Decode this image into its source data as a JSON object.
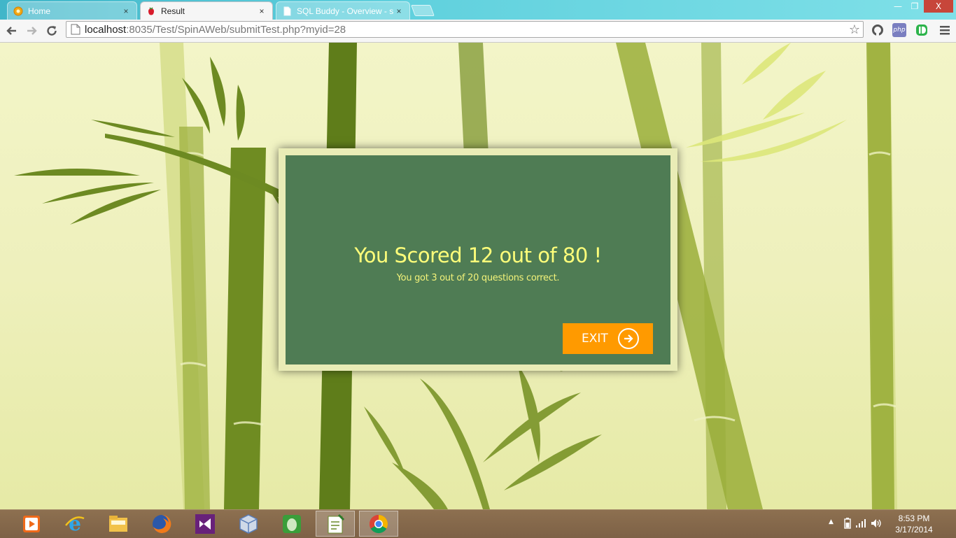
{
  "browser": {
    "tabs": [
      {
        "title": "Home",
        "active": false
      },
      {
        "title": "Result",
        "active": true
      },
      {
        "title": "SQL Buddy - Overview - s",
        "active": false
      }
    ],
    "close_glyph": "×",
    "window_controls": {
      "minimize": "—",
      "restore": "❐",
      "close": "X"
    },
    "url_host": "localhost",
    "url_rest": ":8035/Test/SpinAWeb/submitTest.php?myid=28",
    "extensions": [
      "php"
    ]
  },
  "page": {
    "title": "You Scored 12 out of 80 !",
    "subtitle": "You got 3  out of 20 questions correct.",
    "exit_label": "EXIT"
  },
  "colors": {
    "title_text": "#ffff7a",
    "exit_button": "#ff9a00",
    "panel": "#245c38"
  },
  "taskbar": {
    "apps": [
      "media-player",
      "internet-explorer",
      "file-explorer",
      "firefox",
      "visual-studio",
      "virtualbox",
      "evernote",
      "notepad-plus-plus",
      "chrome"
    ],
    "clock_time": "8:53 PM",
    "clock_date": "3/17/2014"
  }
}
